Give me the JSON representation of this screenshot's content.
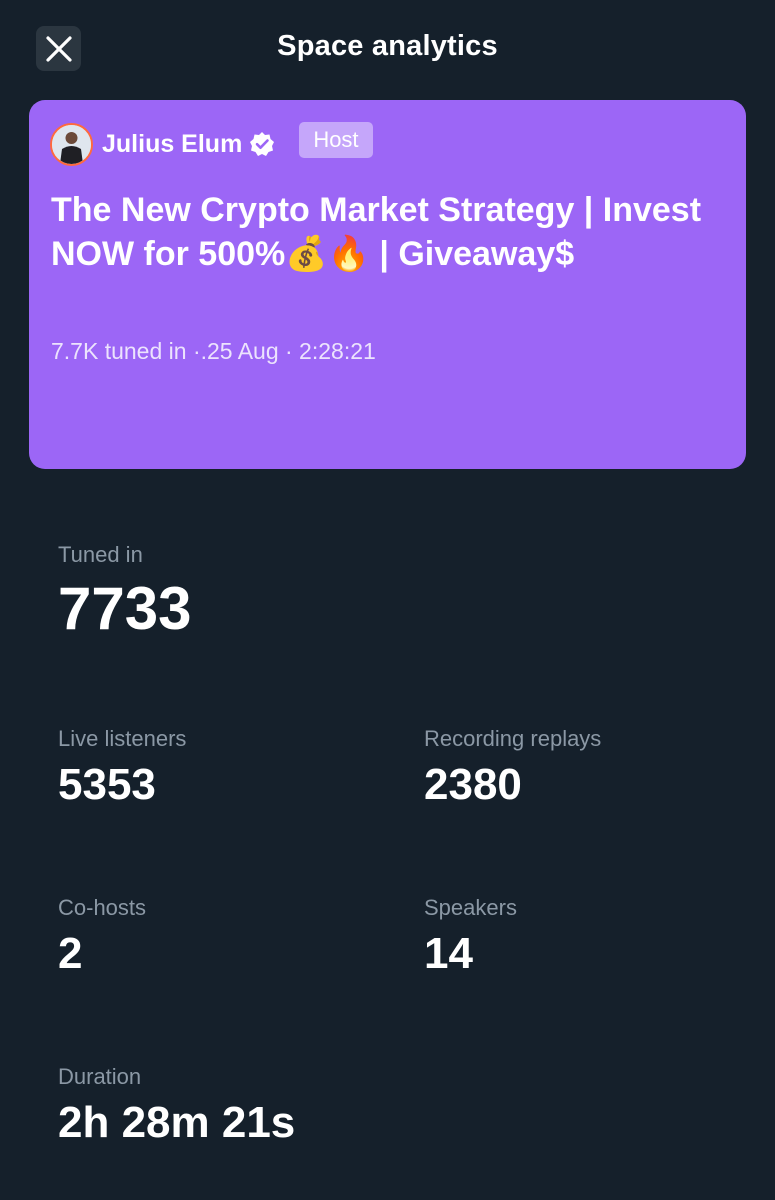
{
  "header": {
    "title": "Space analytics",
    "close_icon": "close-icon"
  },
  "space": {
    "host_name": "Julius Elum",
    "host_badge": "Host",
    "verified_icon": "verified-badge-icon",
    "title": "The New Crypto Market Strategy | Invest NOW for 500%💰🔥 | Giveaway$",
    "meta": "7.7K tuned in ·.25 Aug · 2:28:21",
    "card_color": "#9c66f6"
  },
  "stats": {
    "tuned_in": {
      "label": "Tuned in",
      "value": "7733"
    },
    "live_listeners": {
      "label": "Live listeners",
      "value": "5353"
    },
    "recording_replays": {
      "label": "Recording replays",
      "value": "2380"
    },
    "co_hosts": {
      "label": "Co-hosts",
      "value": "2"
    },
    "speakers": {
      "label": "Speakers",
      "value": "14"
    },
    "duration": {
      "label": "Duration",
      "value": "2h 28m 21s"
    }
  },
  "colors": {
    "background": "#15202b",
    "label": "#8b98a5"
  }
}
